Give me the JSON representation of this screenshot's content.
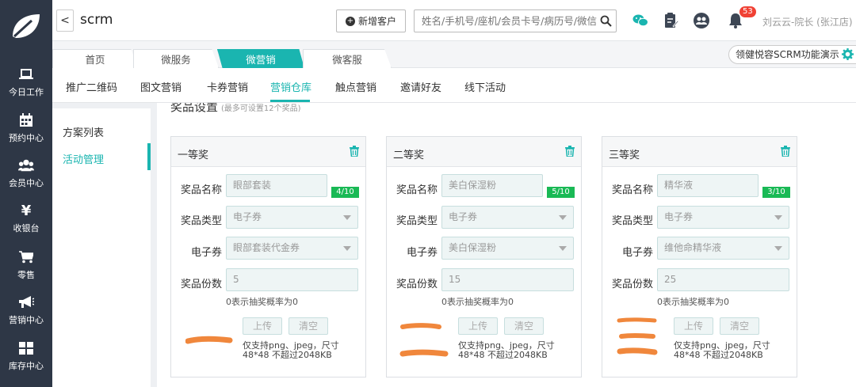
{
  "app": {
    "title": "scrm"
  },
  "header": {
    "back_label": "<",
    "add_customer": "新增客户",
    "search_placeholder": "姓名/手机号/座机/会员卡号/病历号/微信号",
    "notification_count": "53",
    "user_name": "刘云云-院长 (张江店)"
  },
  "sidebar": {
    "items": [
      {
        "label": "今日工作",
        "icon": "laptop-icon"
      },
      {
        "label": "预约中心",
        "icon": "calendar-icon"
      },
      {
        "label": "会员中心",
        "icon": "users-icon"
      },
      {
        "label": "收银台",
        "icon": "yen-icon"
      },
      {
        "label": "零售",
        "icon": "cart-icon"
      },
      {
        "label": "营销中心",
        "icon": "megaphone-icon"
      },
      {
        "label": "库存中心",
        "icon": "grid-icon"
      }
    ]
  },
  "tabs": [
    {
      "label": "首页"
    },
    {
      "label": "微服务"
    },
    {
      "label": "微营销"
    },
    {
      "label": "微客服"
    }
  ],
  "promo": {
    "label": "领健悦容SCRM功能演示"
  },
  "subnav": [
    {
      "label": "推广二维码"
    },
    {
      "label": "图文营销"
    },
    {
      "label": "卡券营销"
    },
    {
      "label": "营销仓库"
    },
    {
      "label": "触点营销"
    },
    {
      "label": "邀请好友"
    },
    {
      "label": "线下活动"
    }
  ],
  "subside": [
    {
      "label": "方案列表"
    },
    {
      "label": "活动管理"
    }
  ],
  "section": {
    "title": "奖品设置",
    "hint": "(最多可设置12个奖品)"
  },
  "labels": {
    "name": "奖品名称",
    "type": "奖品类型",
    "coupon": "电子券",
    "qty": "奖品份数",
    "prob_tip": "0表示抽奖概率为0",
    "upload": "上传",
    "clear": "清空",
    "upload_note": "仅支持png、jpeg，尺寸48*48 不超过2048KB"
  },
  "prizes": [
    {
      "title": "一等奖",
      "name": "眼部套装",
      "counter": "4/10",
      "type": "电子券",
      "coupon": "眼部套装代金券",
      "qty": "5"
    },
    {
      "title": "二等奖",
      "name": "美白保湿粉",
      "counter": "5/10",
      "type": "电子券",
      "coupon": "美白保湿粉",
      "qty": "15"
    },
    {
      "title": "三等奖",
      "name": "精华液",
      "counter": "3/10",
      "type": "电子券",
      "coupon": "维他命精华液",
      "qty": "25"
    }
  ],
  "colors": {
    "accent": "#1ab5b0",
    "sidebar": "#2e3746",
    "counter": "#19b955",
    "badge": "#f04134",
    "scribble": "#f0873c"
  }
}
